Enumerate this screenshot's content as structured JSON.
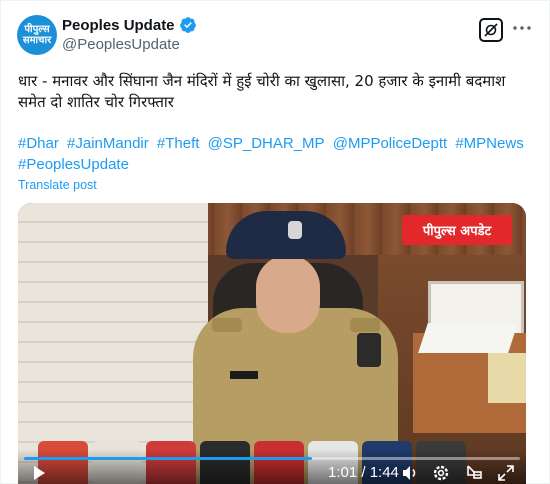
{
  "author": {
    "display_name": "Peoples Update",
    "handle": "@PeoplesUpdate",
    "avatar_text": "पीपुल्स समाचार",
    "verified_color": "#1d9bf0"
  },
  "post": {
    "text": "धार - मनावर और सिंघाना जैन मंदिरों में हुई चोरी का खुलासा, 20 हजार के इनामी बदमाश समेत दो शातिर चोर गिरफ्तार",
    "hashtags": [
      "#Dhar",
      "#JainMandir",
      "#Theft",
      "@SP_DHAR_MP",
      "@MPPoliceDeptt",
      "#MPNews",
      "#PeoplesUpdate"
    ],
    "translate_label": "Translate post"
  },
  "video": {
    "overlay_logo": "पीपुल्स अपडेट",
    "time_display": "1:01 / 1:44",
    "progress_fraction": 0.58,
    "accent_color": "#1d9bf0"
  },
  "icons": {
    "verified": "verified-badge-icon",
    "grok": "grok-icon",
    "more": "more-icon",
    "play": "play-icon",
    "volume": "volume-icon",
    "settings": "settings-gear-icon",
    "pip": "picture-in-picture-icon",
    "fullscreen": "fullscreen-icon"
  }
}
